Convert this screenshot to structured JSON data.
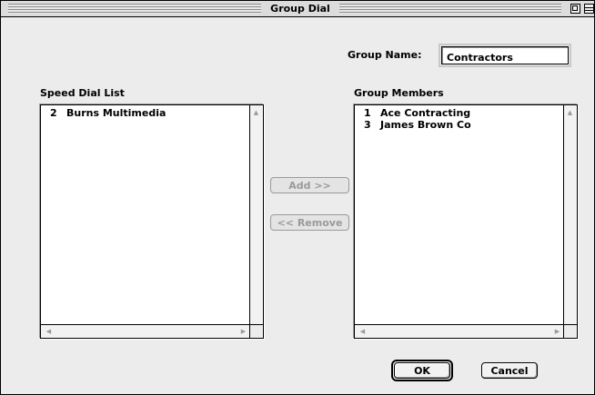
{
  "window": {
    "title": "Group Dial"
  },
  "group_name": {
    "label": "Group Name:",
    "value": "Contractors"
  },
  "speed_dial": {
    "label": "Speed Dial List",
    "items": [
      {
        "num": "2",
        "name": "Burns Multimedia"
      }
    ]
  },
  "group_members": {
    "label": "Group Members",
    "items": [
      {
        "num": "1",
        "name": "Ace Contracting"
      },
      {
        "num": "3",
        "name": "James Brown Co"
      }
    ]
  },
  "buttons": {
    "add": "Add >>",
    "remove": "<< Remove",
    "ok": "OK",
    "cancel": "Cancel"
  },
  "icons": {
    "zoom": "zoom-box-icon",
    "collapse": "collapse-box-icon",
    "scroll_up": "scroll-up-arrow-icon",
    "scroll_down": "scroll-down-arrow-icon",
    "scroll_left": "scroll-left-arrow-icon",
    "scroll_right": "scroll-right-arrow-icon"
  }
}
